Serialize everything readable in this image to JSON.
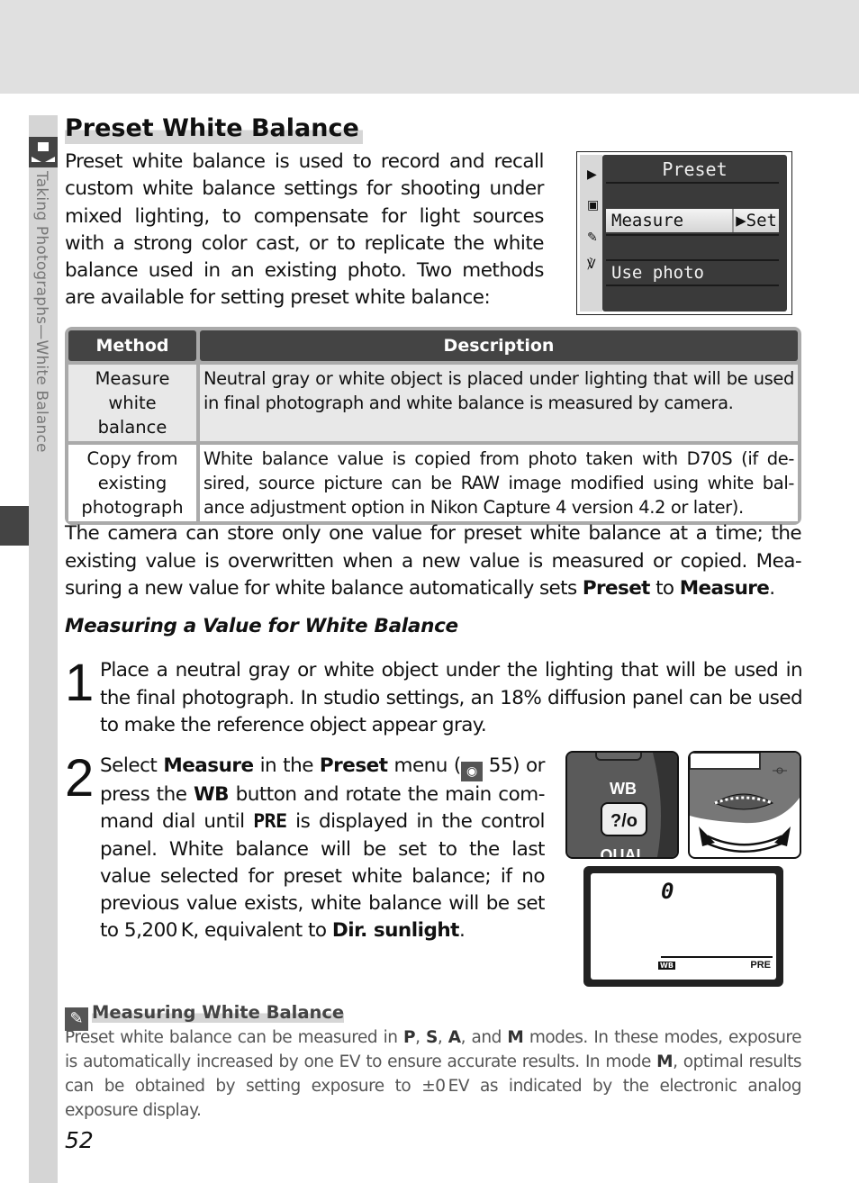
{
  "sidebar": {
    "section_label": "Taking Photographs—White Balance",
    "icon": "camera-menu-icon"
  },
  "page": {
    "title": "Preset White Balance",
    "intro": "Preset white balance is used to record and recall custom white balance settings for shooting under mixed lighting, to compensate for light sources with a strong color cast, or to replicate the white balance used in an existing photo.  Two methods are available for setting preset white balance:",
    "page_number": "52"
  },
  "lcd_menu": {
    "title": "Preset",
    "tabs": [
      "play-icon",
      "camera-icon",
      "pencil-icon",
      "wrench-icon"
    ],
    "items": [
      {
        "label": "Measure",
        "action": "▶Set",
        "selected": true
      },
      {
        "label": "Use photo",
        "action": "",
        "selected": false
      }
    ]
  },
  "methods_table": {
    "headers": [
      "Method",
      "Description"
    ],
    "rows": [
      {
        "method": "Measure white balance",
        "description": "Neutral gray or white object is placed under lighting that will be used in final photograph and white balance is measured by camera."
      },
      {
        "method": "Copy from existing photograph",
        "description": "White balance value is copied from photo taken with D70S (if de-sired, source picture can be RAW image modified using white bal-ance adjustment option in Nikon Capture 4 version 4.2 or later)."
      }
    ]
  },
  "storage_para": {
    "text_a": "The camera can store only one value for preset white balance at a time; the existing  value is overwritten when a new value is measured or copied.  Mea-suring a new value for white balance automatically sets ",
    "bold_a": "Preset",
    "text_b": " to ",
    "bold_b": "Measure",
    "text_c": "."
  },
  "subheading": "Measuring a Value for White Balance",
  "steps": [
    {
      "number": "1",
      "text": "Place a neutral gray or white object under the lighting that will be used in the final photograph.  In studio settings, an 18% diffusion panel can be used to make the reference object appear gray."
    },
    {
      "number": "2",
      "t1": "Select ",
      "b1": "Measure",
      "t2": " in the ",
      "b2": "Preset",
      "t3": " menu (",
      "ref_page": " 55) or press the ",
      "b3": "WB",
      "t4": " button and rotate the main com-mand dial until ",
      "b4": "PRE",
      "t5": " is displayed in the control panel.  White balance will be set to the last value selected for preset white balance; if no previous value exists, white balance will be set to 5,200 K, equivalent to ",
      "b5": "Dir. sunlight",
      "t6": "."
    }
  ],
  "illustrations": {
    "button_label_top": "WB",
    "button_glyph": "?/—",
    "button_label_bottom": "QUAL",
    "control_panel_digit": "0",
    "control_panel_wb": "WB",
    "control_panel_pre": "PRE"
  },
  "note": {
    "title": "Measuring White Balance",
    "t1": "Preset white balance can be measured in ",
    "m1": "P",
    "s1": ", ",
    "m2": "S",
    "s2": ", ",
    "m3": "A",
    "s3": ", and ",
    "m4": "M",
    "t2": " modes.  In these modes, exposure is automatically increased by one EV to ensure accurate results.  In mode ",
    "m5": "M",
    "t3": ", optimal results can be obtained by setting exposure to ±0 EV as indicated by the electronic analog exposure display."
  }
}
